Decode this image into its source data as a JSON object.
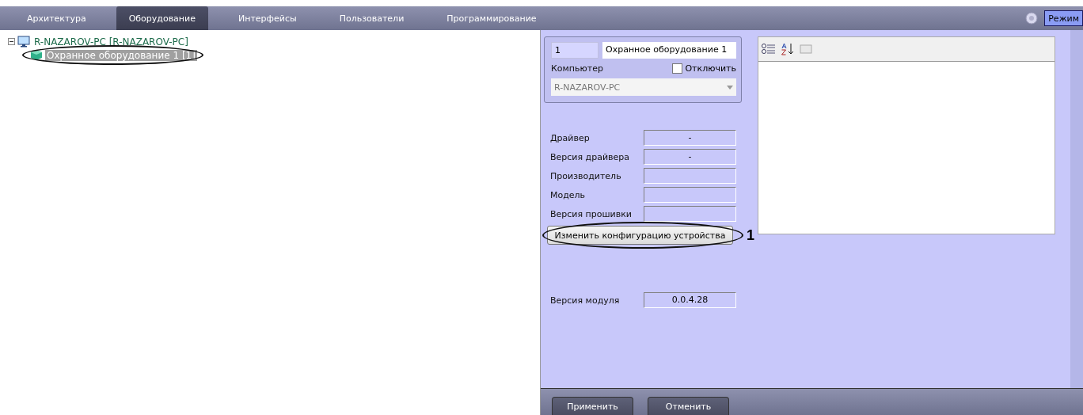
{
  "tabs": [
    {
      "label": "Архитектура",
      "selected": false
    },
    {
      "label": "Оборудование",
      "selected": true
    },
    {
      "label": "Интерфейсы",
      "selected": false
    },
    {
      "label": "Пользователи",
      "selected": false
    },
    {
      "label": "Программирование",
      "selected": false
    }
  ],
  "mode_button": {
    "label": "Режим"
  },
  "tree": [
    {
      "label": "R-NAZAROV-PC [R-NAZAROV-PC]",
      "kind": "computer",
      "expanded": true,
      "selected": false,
      "children": [
        {
          "label": "Охранное оборудование 1 [1]",
          "kind": "device",
          "selected": true,
          "circled": true
        }
      ]
    }
  ],
  "object": {
    "id": "1",
    "name": "Охранное оборудование 1",
    "computer_label": "Компьютер",
    "disable": {
      "label": "Отключить",
      "checked": false
    },
    "computer": {
      "value": "R-NAZAROV-PC",
      "disabled": true
    }
  },
  "info": [
    {
      "label": "Драйвер",
      "value": "-"
    },
    {
      "label": "Версия драйвера",
      "value": "-"
    },
    {
      "label": "Производитель"
    },
    {
      "label": "Модель"
    },
    {
      "label": "Версия прошивки"
    }
  ],
  "config_button": {
    "label": "Изменить конфигурацию устройства",
    "callout": "1"
  },
  "module_version": {
    "label": "Версия модуля",
    "value": "0.0.4.28"
  },
  "footer_buttons": [
    "Применить",
    "Отменить"
  ]
}
